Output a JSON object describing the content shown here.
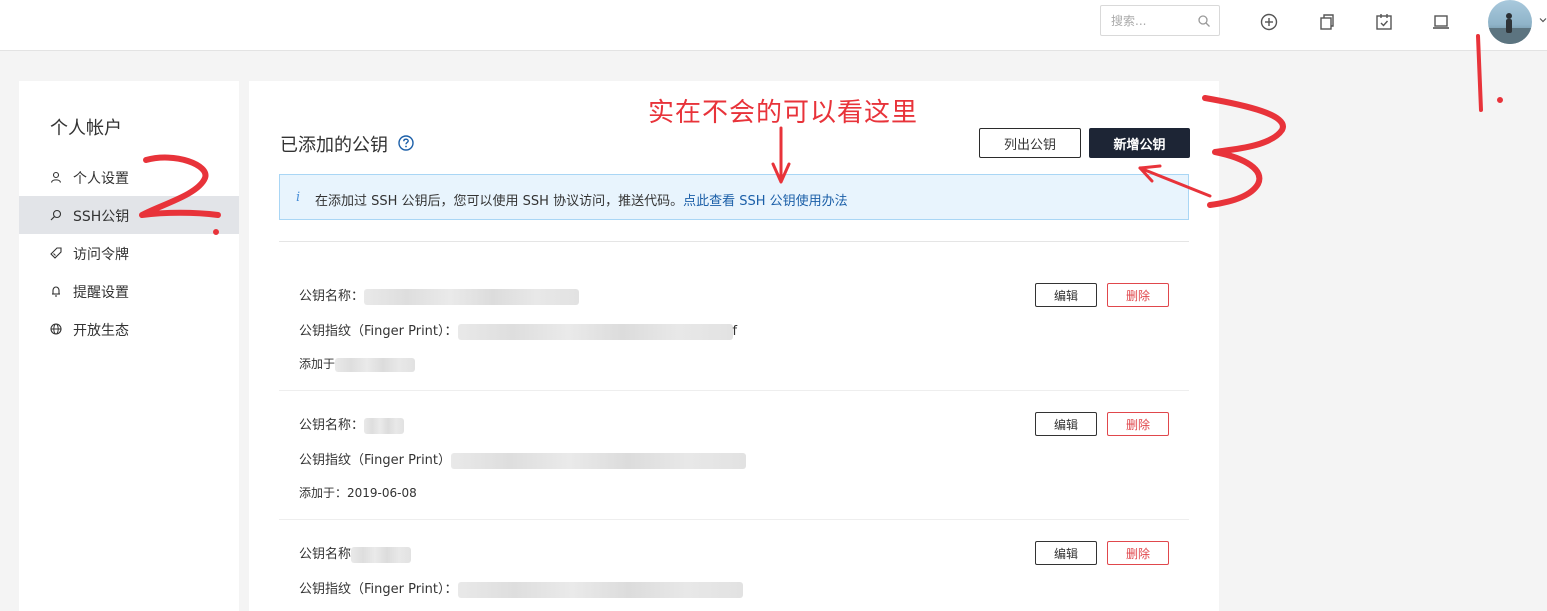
{
  "topbar": {
    "search_placeholder": "搜索...",
    "icons": [
      "plus-circle-icon",
      "copy-icon",
      "calendar-check-icon",
      "laptop-icon"
    ]
  },
  "sidebar": {
    "title": "个人帐户",
    "items": [
      {
        "label": "个人设置",
        "icon": "user-icon"
      },
      {
        "label": "SSH公钥",
        "icon": "search-key-icon",
        "active": true
      },
      {
        "label": "访问令牌",
        "icon": "tag-icon"
      },
      {
        "label": "提醒设置",
        "icon": "bell-icon"
      },
      {
        "label": "开放生态",
        "icon": "globe-icon"
      }
    ]
  },
  "main": {
    "title": "已添加的公钥",
    "list_button": "列出公钥",
    "add_button": "新增公钥",
    "notice": {
      "text": "在添加过 SSH 公钥后，您可以使用 SSH 协议访问，推送代码。",
      "link": "点此查看 SSH 公钥使用办法"
    },
    "keys": [
      {
        "name_label": "公钥名称：",
        "fp_label": "公钥指纹（Finger Print）：",
        "fp_tail": "f",
        "added_label": "添加于",
        "added_date": ""
      },
      {
        "name_label": "公钥名称：",
        "fp_label": "公钥指纹（Finger Print）",
        "fp_tail": "",
        "added_label": "添加于：",
        "added_date": "2019-06-08"
      },
      {
        "name_label": "公钥名称",
        "fp_label": "公钥指纹（Finger Print）：",
        "fp_tail": "",
        "added_label": "",
        "added_date": ""
      }
    ],
    "edit_label": "编辑",
    "delete_label": "删除"
  },
  "annotation": {
    "hint": "实在不会的可以看这里",
    "color": "#e8333a"
  }
}
